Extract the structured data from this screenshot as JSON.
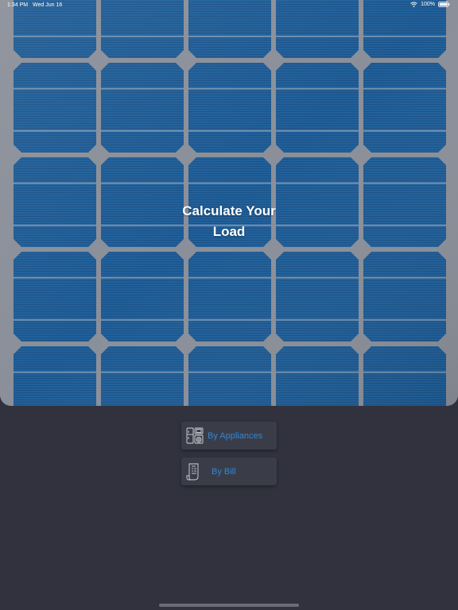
{
  "status_bar": {
    "time": "1:34 PM",
    "date": "Wed Jun 16",
    "battery": "100%",
    "icons": [
      "wifi-icon",
      "battery-icon"
    ]
  },
  "hero": {
    "title_line1": "Calculate Your",
    "title_line2": "Load"
  },
  "actions": {
    "by_appliances": "By Appliances",
    "by_appliances_icon": "appliances-icon",
    "by_bill": "By Bill",
    "by_bill_icon": "bill-receipt-icon"
  },
  "colors": {
    "background": "#31323d",
    "button": "#3a3d48",
    "accent": "#2f86d6",
    "panel_cell": "#1f5b92",
    "panel_frame": "#8a8f99"
  }
}
